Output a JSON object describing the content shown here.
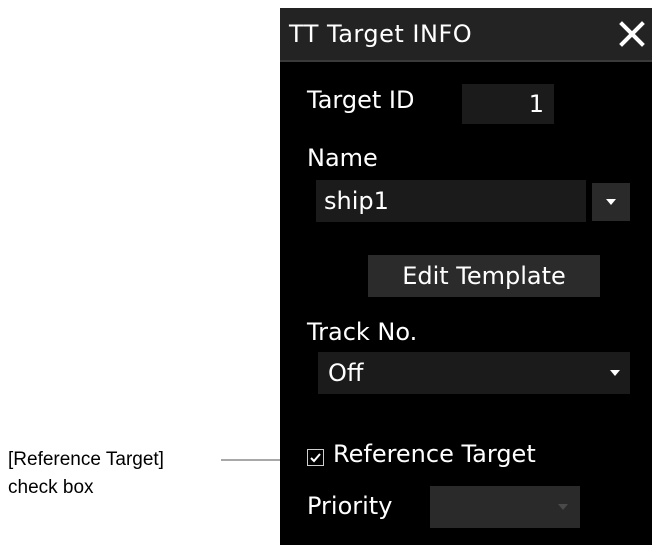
{
  "annotation": {
    "line1": "[Reference Target]",
    "line2": "check box"
  },
  "dialog": {
    "title": "TT Target INFO",
    "close_icon": "close-icon",
    "target_id_label": "Target ID",
    "target_id_value": "1",
    "name_label": "Name",
    "name_value": "ship1",
    "edit_template_label": "Edit Template",
    "track_no_label": "Track No.",
    "track_no_value": "Off",
    "reference_target_label": "Reference Target",
    "reference_target_checked": true,
    "priority_label": "Priority",
    "priority_value": "",
    "priority_enabled": false
  },
  "colors": {
    "panel_bg": "#000000",
    "titlebar_bg": "#232323",
    "field_bg": "#1b1b1b",
    "button_bg": "#2b2b2b",
    "disabled_bg": "#2a2a2a",
    "text": "#ffffff",
    "leader_line": "#a8a8a8"
  }
}
